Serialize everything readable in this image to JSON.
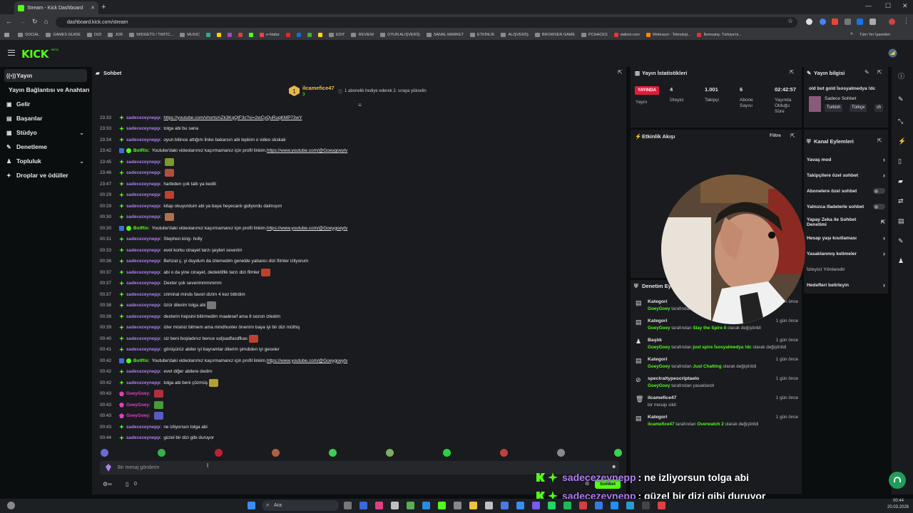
{
  "browser": {
    "tab_title": "Stream - Kick Dashboard",
    "url": "dashboard.kick.com/stream",
    "bookmarks": [
      "SOCIAL",
      "GAMES GUIDE",
      "DIZI",
      "JOB",
      "WIDGETS / TWITC...",
      "MUSIC",
      "e-Nabiz",
      "EDIT",
      "REVIEW",
      "OYUN ALIŞVERİŞ",
      "SANAL MARKET",
      "ETKİNLİK",
      "ALIŞVERİŞ",
      "BROWSER GAME",
      "PCHACKS",
      "dafont.com",
      "Webrazzi - Teknoloji...",
      "İtemsatış: Türkiye'ni..."
    ],
    "all_bookmarks": "Tüm Yer İşaretleri"
  },
  "brand": {
    "logo": "KICK",
    "beta": "BETA",
    "accent": "#53fc18"
  },
  "sidebar": {
    "items": [
      {
        "label": "Yayın",
        "icon": "broadcast-icon"
      },
      {
        "label": "Yayın Bağlantısı ve Anahtarı",
        "icon": ""
      },
      {
        "label": "Gelir",
        "icon": "wallet-icon"
      },
      {
        "label": "Başarılar",
        "icon": "trophy-icon"
      },
      {
        "label": "Stüdyo",
        "icon": "studio-icon"
      },
      {
        "label": "Denetleme",
        "icon": "wrench-icon"
      },
      {
        "label": "Topluluk",
        "icon": "users-icon"
      },
      {
        "label": "Droplar ve ödüller",
        "icon": "gift-icon"
      }
    ]
  },
  "chat": {
    "title": "Sohbet",
    "pinned": {
      "user": "ilcamefice47",
      "count": "3",
      "text": "1 abonelik hediye ederek 2. sıraya yükselin"
    },
    "messages": [
      {
        "time": "23:33",
        "user": "sadecezeynepp",
        "text": "https://youtube.com/shorts/nZk3KqQtF3c?si=2wCyQuRuqKMP73wY",
        "link": true
      },
      {
        "time": "23:33",
        "user": "sadecezeynepp",
        "text": "tolga abi bu sana"
      },
      {
        "time": "23:34",
        "user": "sadecezeynepp",
        "text": "oyun bitince attığım linke bakarsın abi tepkim o video skskak"
      },
      {
        "time": "23:42",
        "user": "BotRix",
        "text": "Youtube'daki videolarımız kaçırmamanız için profil linkim. ",
        "link_text": "https://www.youtube.com/@Goeygoeytv",
        "bot": true
      },
      {
        "time": "23:45",
        "user": "sadecezeynepp",
        "text": ""
      },
      {
        "time": "23:46",
        "user": "sadecezeynepp",
        "text": ""
      },
      {
        "time": "23:47",
        "user": "sadecezeynepp",
        "text": "harbiden çok tatlı ya kedili"
      },
      {
        "time": "00:29",
        "user": "sadecezeynepp",
        "text": ""
      },
      {
        "time": "00:29",
        "user": "sadecezeynepp",
        "text": "kitap okuyordum abi ya baya heyecanlı gidiyordu dalmışım"
      },
      {
        "time": "00:30",
        "user": "sadecezeynepp",
        "text": ""
      },
      {
        "time": "00:30",
        "user": "BotRix",
        "text": "Youtube'daki videolarımız kaçırmamanız için profil linkim. ",
        "link_text": "https://www.youtube.com/@Goeygoeytv",
        "bot": true
      },
      {
        "time": "00:31",
        "user": "sadecezeynepp",
        "text": "Stephen king- holly"
      },
      {
        "time": "00:33",
        "user": "sadecezeynepp",
        "text": "evet korku cinayet tarzı şeyleri severim"
      },
      {
        "time": "00:36",
        "user": "sadecezeynepp",
        "text": "Behzat ç. yi duydum da izlemedim genelde yabancı dizi filmler izliyorum"
      },
      {
        "time": "00:37",
        "user": "sadecezeynepp",
        "text": "abi o da yine cinayet, dedektiflik tarzı dizi filmler"
      },
      {
        "time": "00:37",
        "user": "sadecezeynepp",
        "text": "Dexter çok severimmmmmm"
      },
      {
        "time": "00:37",
        "user": "sadecezeynepp",
        "text": "criminal minds favori dizim 4 kez bitirdim"
      },
      {
        "time": "00:38",
        "user": "sadecezeynepp",
        "text": "özür dilerim tolga abi"
      },
      {
        "time": "00:38",
        "user": "sadecezeynepp",
        "text": "dexterin hepsini bitirmedim maalesef ama 8 sezon izledim"
      },
      {
        "time": "00:39",
        "user": "sadecezeynepp",
        "text": "izler misiniz bilmem ama mindhunter önerirm baya iyi bir dizi müthiş"
      },
      {
        "time": "00:40",
        "user": "sadecezeynepp",
        "text": "siz beni boşladınız bence sıdjsadfasdfkas"
      },
      {
        "time": "00:41",
        "user": "sadecezeynepp",
        "text": "görüşürüz abiler iyi bayramlar dilerim şimdiden iyi geceler"
      },
      {
        "time": "00:42",
        "user": "BotRix",
        "text": "Youtube'daki videolarımız kaçırmamanız için profil linkim. ",
        "link_text": "https://www.youtube.com/@Goeygoeytv",
        "bot": true
      },
      {
        "time": "00:42",
        "user": "sadecezeynepp",
        "text": "evet diğer abilere dedim"
      },
      {
        "time": "00:42",
        "user": "sadecezeynepp",
        "text": "tolga abi beni çözmüş"
      },
      {
        "time": "00:43",
        "user": "GoeyGoey",
        "text": "",
        "owner": true
      },
      {
        "time": "00:43",
        "user": "GoeyGoey",
        "text": "",
        "owner": true
      },
      {
        "time": "00:43",
        "user": "GoeyGoey",
        "text": "",
        "owner": true
      },
      {
        "time": "00:43",
        "user": "sadecezeynepp",
        "text": "ne izliyorsun tolga abi"
      },
      {
        "time": "00:44",
        "user": "sadecezeynepp",
        "text": "güzel bir dizi gibi duruyor"
      }
    ],
    "input_placeholder": "Bir mesaj gönderin",
    "send_label": "Sohbet",
    "viewer_count": "0"
  },
  "stats": {
    "title": "Yayın İstatistikleri",
    "live_badge": "YAYINDA",
    "live_label": "Yayın",
    "viewers": "4",
    "viewers_label": "İzleyici",
    "followers": "1.001",
    "followers_label": "Takipçi",
    "subs": "6",
    "subs_label": "Abone Sayısı",
    "duration": "02:42:57",
    "duration_label": "Yayında Olduğu Süre"
  },
  "info": {
    "title": "Yayın bilgisi",
    "stream_title": "old but gold İsosyalmedya !dc",
    "category": "Sadece Sohbet",
    "tags": [
      "Turkish",
      "Türkçe",
      "ch"
    ]
  },
  "activity": {
    "title": "Etkinlik Akışı",
    "filter": "Filtre"
  },
  "actions": {
    "title": "Kanal Eylemleri",
    "items": [
      {
        "label": "Yavaş mod",
        "kind": "arrow"
      },
      {
        "label": "Takipçilere özel sohbet",
        "kind": "arrow"
      },
      {
        "label": "Abonelere özel sohbet",
        "kind": "toggle"
      },
      {
        "label": "Yalnızca ifadelerle sohbet",
        "kind": "toggle"
      },
      {
        "label": "Yapay Zeka ile Sohbet Denetimi",
        "kind": "ext"
      },
      {
        "label": "Hesap yaşı kısıtlaması",
        "kind": "arrow"
      },
      {
        "label": "Yasaklanmış kelimeler",
        "kind": "arrow"
      },
      {
        "label": "İzleyici Yönlendir",
        "kind": "none"
      },
      {
        "label": "Hedefleri belirleyin",
        "kind": "arrow"
      }
    ]
  },
  "modlog": {
    "title": "Denetim Eylemleri",
    "entries": [
      {
        "title": "Kategori",
        "actor": "GoeyGoey",
        "mid": " tarafından ",
        "target": "",
        "tail": "",
        "time": "1 gün önce"
      },
      {
        "title": "Kategori",
        "actor": "GoeyGoey",
        "mid": " tarafından ",
        "target": "Slay the Spire II",
        "tail": " olarak değiştirildi",
        "time": "1 gün önce"
      },
      {
        "title": "Başlık",
        "actor": "GoeyGoey",
        "mid": " tarafından ",
        "target": "just spire İsosyalmedya !dc",
        "tail": " olarak değiştirildi",
        "time": "1 gün önce"
      },
      {
        "title": "Kategori",
        "actor": "GoeyGoey",
        "mid": " tarafından ",
        "target": "Just Chatting",
        "tail": " olarak değiştirildi",
        "time": "1 gün önce"
      },
      {
        "title": "spectraltypescriptaelo",
        "actor": "GoeyGoey",
        "mid": " tarafından yasaklandı",
        "target": "",
        "tail": "",
        "time": "1 gün önce"
      },
      {
        "title": "ilcamefice47",
        "actor": "",
        "mid": "bir mesajı sildi",
        "target": "",
        "tail": "",
        "time": "1 gün önce"
      },
      {
        "title": "Kategori",
        "actor": "ilcamefice47",
        "mid": " tarafından ",
        "target": "Overwatch 2",
        "tail": " olarak değiştirildi",
        "time": "1 gün önce"
      }
    ]
  },
  "overlay": [
    {
      "user": "sadecezeynepp",
      "text": ": ne izliyorsun tolga abi"
    },
    {
      "user": "sadecezeynepp",
      "text": ": güzel bir dizi gibi duruyor"
    }
  ],
  "taskbar": {
    "search": "Ara",
    "time": "00:44",
    "date": "20.03.2026"
  }
}
